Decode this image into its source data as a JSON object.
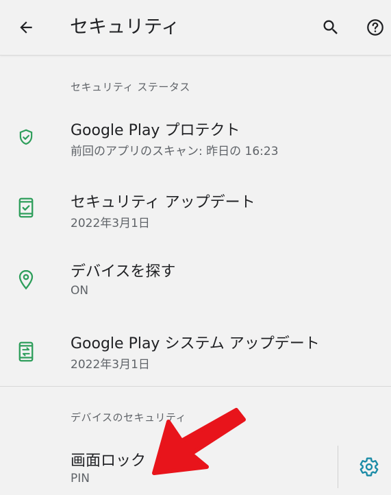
{
  "appbar": {
    "title": "セキュリティ",
    "back_icon": "arrow-back-icon",
    "search_icon": "search-icon",
    "help_icon": "help-icon"
  },
  "sections": {
    "security_status": {
      "header": "セキュリティ ステータス",
      "items": [
        {
          "icon": "shield-check-icon",
          "title": "Google Play プロテクト",
          "subtitle": "前回のアプリのスキャン: 昨日の 16:23"
        },
        {
          "icon": "phone-update-icon",
          "title": "セキュリティ アップデート",
          "subtitle": "2022年3月1日"
        },
        {
          "icon": "location-pin-icon",
          "title": "デバイスを探す",
          "subtitle": "ON"
        },
        {
          "icon": "system-update-icon",
          "title": "Google Play システム アップデート",
          "subtitle": "2022年3月1日"
        }
      ]
    },
    "device_security": {
      "header": "デバイスのセキュリティ",
      "screen_lock": {
        "title": "画面ロック",
        "subtitle": "PIN",
        "settings_icon": "gear-icon"
      }
    }
  },
  "colors": {
    "accent_green": "#2e9e5b",
    "gear_teal": "#1a8ba6",
    "annotation_red": "#e8141b"
  }
}
